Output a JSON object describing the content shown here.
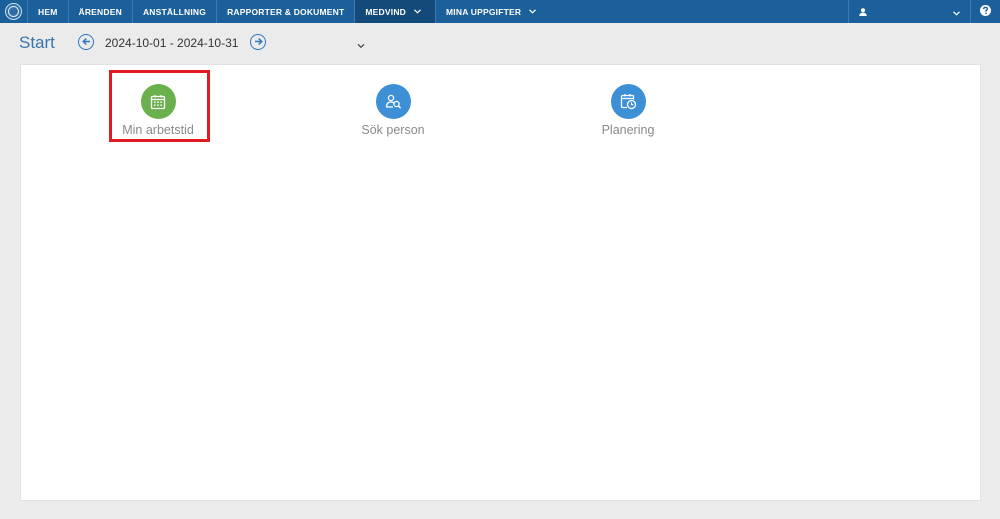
{
  "nav": {
    "items": [
      {
        "label": "HEM"
      },
      {
        "label": "ÄRENDEN"
      },
      {
        "label": "ANSTÄLLNING"
      },
      {
        "label": "RAPPORTER & DOKUMENT"
      },
      {
        "label": "MEDVIND"
      },
      {
        "label": "MINA UPPGIFTER"
      }
    ],
    "logo_icon": "kth-logo",
    "user_icon": "user-icon",
    "help_icon": "question-icon"
  },
  "header": {
    "title": "Start",
    "date_range": "2024-10-01 - 2024-10-31"
  },
  "tiles": [
    {
      "label": "Min arbetstid",
      "icon": "calendar-icon",
      "color": "#6ab04c"
    },
    {
      "label": "Sök person",
      "icon": "person-search-icon",
      "color": "#3d8fd6"
    },
    {
      "label": "Planering",
      "icon": "calendar-clock-icon",
      "color": "#3d8fd6"
    }
  ],
  "colors": {
    "navbar": "#1b5f9b",
    "active_nav": "#134a7a",
    "accent": "#2e77c0",
    "highlight": "#e11b22"
  }
}
